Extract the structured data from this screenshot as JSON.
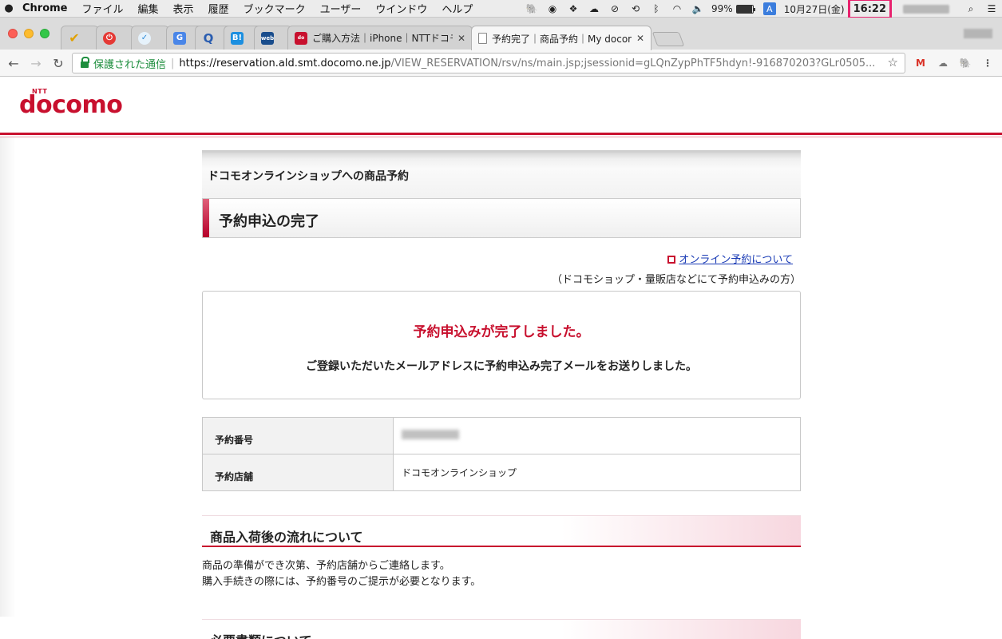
{
  "menubar": {
    "app": "Chrome",
    "items": [
      "ファイル",
      "編集",
      "表示",
      "履歴",
      "ブックマーク",
      "ユーザー",
      "ウインドウ",
      "ヘルプ"
    ],
    "battery": "99%",
    "ime": "A",
    "date": "10月27日(金)",
    "time": "16:22"
  },
  "tabs": [
    {
      "label": "ご購入方法｜iPhone｜NTTドコモ"
    },
    {
      "label": "予約完了｜商品予約｜My docomo"
    }
  ],
  "pinned_tab_icons": [
    "check",
    "power",
    "checkmark-circle",
    "translate",
    "Q",
    "B!",
    "web"
  ],
  "address": {
    "secure_label": "保護された通信",
    "host": "https://reservation.ald.smt.docomo.ne.jp",
    "path": "/VIEW_RESERVATION/rsv/ns/main.jsp;jsessionid=gLQnZypPhTF5hdyn!-916870203?GLr0505..."
  },
  "logo": {
    "ntt": "NTT",
    "brand": "docomo"
  },
  "shop_header": "ドコモオンラインショップへの商品予約",
  "page_title": "予約申込の完了",
  "online_link": "オンライン予約について",
  "online_note": "（ドコモショップ・量販店などにて予約申込みの方）",
  "done": {
    "title": "予約申込みが完了しました。",
    "message": "ご登録いただいたメールアドレスに予約申込み完了メールをお送りしました。"
  },
  "info_table": {
    "rows": [
      {
        "label": "予約番号",
        "value": ""
      },
      {
        "label": "予約店舗",
        "value": "ドコモオンラインショップ"
      }
    ]
  },
  "section1": {
    "heading": "商品入荷後の流れについて",
    "lines": [
      "商品の準備ができ次第、予約店舗からご連絡します。",
      "購入手続きの際には、予約番号のご提示が必要となります。"
    ]
  },
  "section2": {
    "heading": "必要書類について"
  },
  "colors": {
    "brand": "#c8102e",
    "link": "#1a3bb5",
    "highlight": "#e8226e"
  }
}
